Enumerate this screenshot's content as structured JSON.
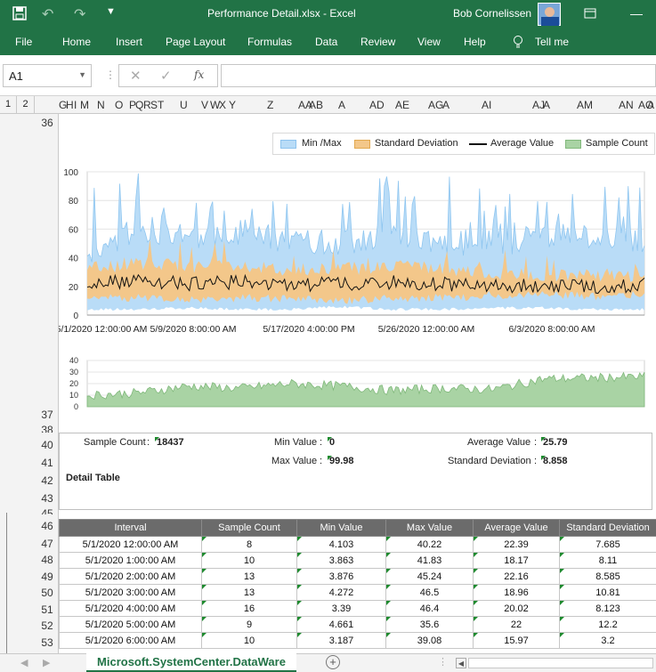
{
  "titlebar": {
    "title": "Performance Detail.xlsx  -  Excel",
    "user": "Bob Cornelissen"
  },
  "ribbon": {
    "tabs": [
      "File",
      "Home",
      "Insert",
      "Page Layout",
      "Formulas",
      "Data",
      "Review",
      "View",
      "Help"
    ],
    "tell_me": "Tell me"
  },
  "formula_bar": {
    "name_box": "A1",
    "fx": "fx",
    "content": ""
  },
  "outline_levels": [
    "1",
    "2"
  ],
  "columns": [
    "G",
    "H",
    "I",
    "M",
    "N",
    "O",
    "P",
    "Q",
    "R",
    "S",
    "T",
    "U",
    "V",
    "W",
    "X",
    "Y",
    "Z",
    "AA",
    "AB",
    "A",
    "AD",
    "AE",
    "AG",
    "A",
    "AI",
    "AJ",
    "A",
    "AM",
    "AN",
    "AO",
    "A"
  ],
  "row_numbers": [
    "36",
    "37",
    "38",
    "40",
    "41",
    "42",
    "43",
    "45",
    "46",
    "47",
    "48",
    "49",
    "50",
    "51",
    "52",
    "53"
  ],
  "chart": {
    "legend": [
      "Min /Max",
      "Standard Deviation",
      "Average Value",
      "Sample Count"
    ],
    "colors": {
      "minmax": "#b9dcf7",
      "stddev": "#f3c78a",
      "avg": "#111111",
      "count": "#a9d3a4"
    }
  },
  "chart_data": [
    {
      "type": "area",
      "x_tick_labels": [
        "5/1/2020 12:00:00 AM",
        "5/9/2020 8:00:00 AM",
        "5/17/2020 4:00:00 PM",
        "5/26/2020 12:00:00 AM",
        "6/3/2020 8:00:00 AM"
      ],
      "ylim": [
        0,
        100
      ],
      "y_ticks": [
        0,
        20,
        40,
        60,
        80,
        100
      ],
      "series": [
        {
          "name": "Min /Max",
          "low_approx": [
            3,
            3,
            4,
            3,
            3,
            5,
            3,
            3,
            4,
            4,
            3,
            3
          ],
          "high_approx": [
            40,
            60,
            55,
            58,
            52,
            50,
            55,
            52,
            48,
            56,
            55,
            50
          ]
        },
        {
          "name": "Standard Deviation",
          "low_approx": [
            14,
            12,
            10,
            12,
            11,
            10,
            12,
            12,
            14,
            14,
            13,
            14
          ],
          "high_approx": [
            32,
            36,
            34,
            35,
            32,
            32,
            34,
            33,
            28,
            28,
            28,
            28
          ]
        },
        {
          "name": "Average Value",
          "values_approx": [
            22,
            24,
            22,
            23,
            21,
            22,
            23,
            22,
            20,
            21,
            20,
            21
          ]
        }
      ],
      "grid": true
    },
    {
      "type": "area",
      "ylim": [
        0,
        40
      ],
      "y_ticks": [
        0,
        10,
        20,
        30,
        40
      ],
      "series": [
        {
          "name": "Sample Count",
          "values_approx": [
            10,
            12,
            18,
            16,
            20,
            18,
            14,
            16,
            15,
            24,
            25,
            26
          ]
        }
      ],
      "grid": true
    },
    {
      "type": "table",
      "columns": [
        "Interval",
        "Sample Count",
        "Min Value",
        "Max Value",
        "Average Value",
        "Standard Deviation"
      ],
      "rows": [
        [
          "5/1/2020 12:00:00 AM",
          "8",
          "4.103",
          "40.22",
          "22.39",
          "7.685"
        ],
        [
          "5/1/2020 1:00:00 AM",
          "10",
          "3.863",
          "41.83",
          "18.17",
          "8.11"
        ],
        [
          "5/1/2020 2:00:00 AM",
          "13",
          "3.876",
          "45.24",
          "22.16",
          "8.585"
        ],
        [
          "5/1/2020 3:00:00 AM",
          "13",
          "4.272",
          "46.5",
          "18.96",
          "10.81"
        ],
        [
          "5/1/2020 4:00:00 AM",
          "16",
          "3.39",
          "46.4",
          "20.02",
          "8.123"
        ],
        [
          "5/1/2020 5:00:00 AM",
          "9",
          "4.661",
          "35.6",
          "22",
          "12.2"
        ],
        [
          "5/1/2020 6:00:00 AM",
          "10",
          "3.187",
          "39.08",
          "15.97",
          "3.2"
        ]
      ]
    }
  ],
  "summary": {
    "sample_count_label": "Sample Count",
    "sample_count": "18437",
    "min_label": "Min Value",
    "min": "0",
    "max_label": "Max Value",
    "max": "99.98",
    "avg_label": "Average Value",
    "avg": "25.79",
    "std_label": "Standard Deviation",
    "std": "8.858",
    "colon": ":",
    "detail_title": "Detail Table"
  },
  "sheet": {
    "tab": "Microsoft.SystemCenter.DataWare"
  }
}
